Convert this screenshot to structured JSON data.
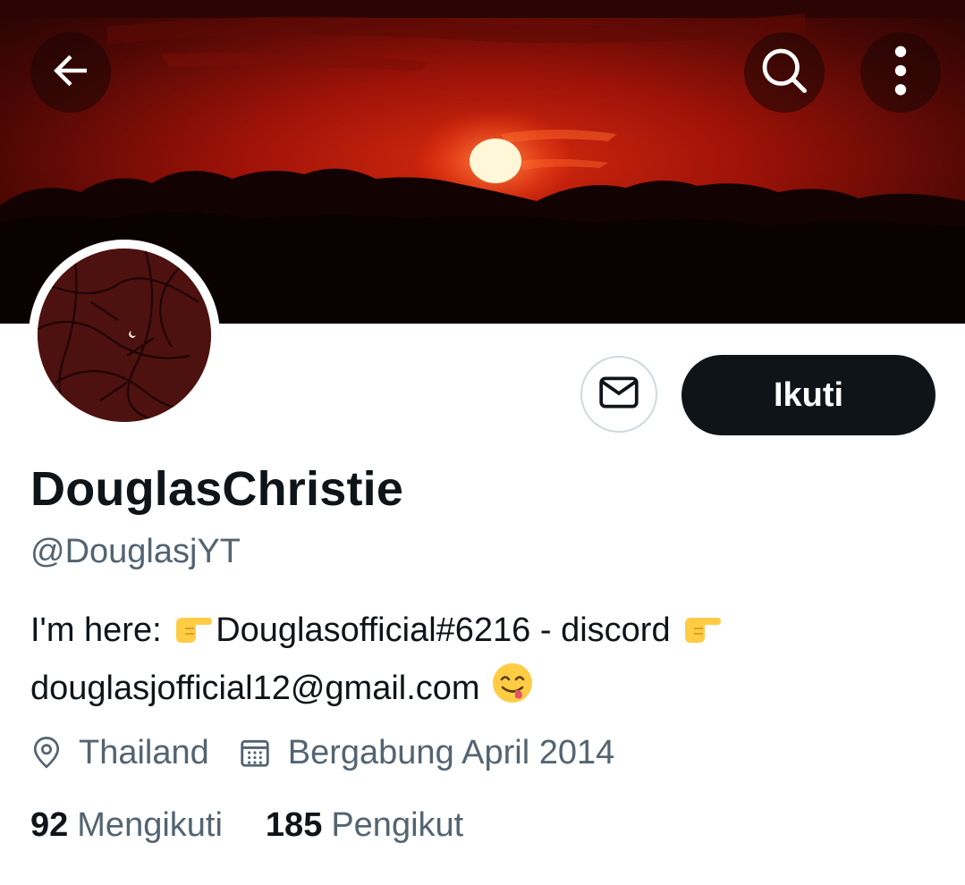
{
  "profile": {
    "display_name": "DouglasChristie",
    "handle": "@DouglasjYT",
    "bio_line1_prefix": "I'm here: ",
    "bio_line1_mid": "Douglasofficial#6216 - discord ",
    "bio_line2": "douglasjofficial12@gmail.com",
    "location": "Thailand",
    "joined": "Bergabung April 2014"
  },
  "actions": {
    "follow_label": "Ikuti"
  },
  "stats": {
    "following_count": "92",
    "following_label": "Mengikuti",
    "followers_count": "185",
    "followers_label": "Pengikut"
  },
  "icons": {
    "back": "arrow-left-icon",
    "search": "search-icon",
    "more": "more-vertical-icon",
    "message": "envelope-icon",
    "location": "location-pin-icon",
    "calendar": "calendar-icon",
    "emoji_point": "backhand-index-pointing-right",
    "emoji_yum": "face-savoring-food"
  },
  "colors": {
    "primary_text": "#0f1419",
    "secondary_text": "#536471",
    "follow_button_bg": "#0f1419",
    "border": "#cfd9de"
  }
}
